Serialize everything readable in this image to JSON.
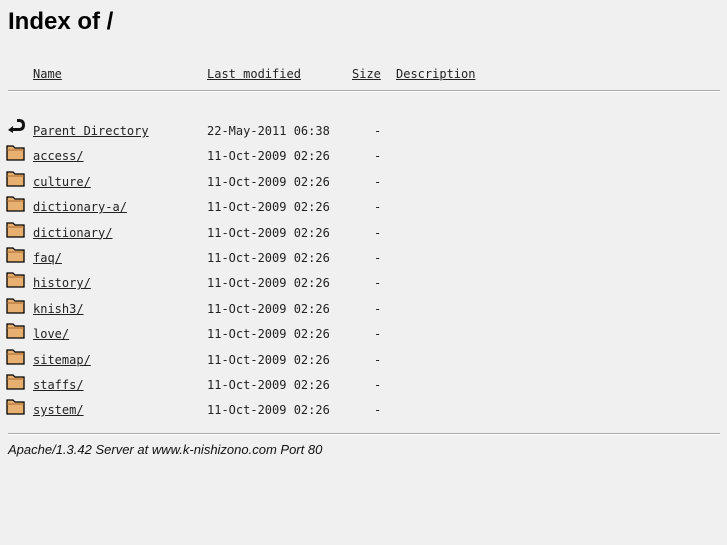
{
  "title": "Index of /",
  "headers": {
    "name": "Name",
    "last_modified": "Last modified",
    "size": "Size",
    "description": "Description"
  },
  "rows": [
    {
      "icon": "back-icon",
      "name": "Parent Directory",
      "modified": "22-May-2011 06:38",
      "size": "-"
    },
    {
      "icon": "folder-icon",
      "name": "access/",
      "modified": "11-Oct-2009 02:26",
      "size": "-"
    },
    {
      "icon": "folder-icon",
      "name": "culture/",
      "modified": "11-Oct-2009 02:26",
      "size": "-"
    },
    {
      "icon": "folder-icon",
      "name": "dictionary-a/",
      "modified": "11-Oct-2009 02:26",
      "size": "-"
    },
    {
      "icon": "folder-icon",
      "name": "dictionary/",
      "modified": "11-Oct-2009 02:26",
      "size": "-"
    },
    {
      "icon": "folder-icon",
      "name": "faq/",
      "modified": "11-Oct-2009 02:26",
      "size": "-"
    },
    {
      "icon": "folder-icon",
      "name": "history/",
      "modified": "11-Oct-2009 02:26",
      "size": "-"
    },
    {
      "icon": "folder-icon",
      "name": "knish3/",
      "modified": "11-Oct-2009 02:26",
      "size": "-"
    },
    {
      "icon": "folder-icon",
      "name": "love/",
      "modified": "11-Oct-2009 02:26",
      "size": "-"
    },
    {
      "icon": "folder-icon",
      "name": "sitemap/",
      "modified": "11-Oct-2009 02:26",
      "size": "-"
    },
    {
      "icon": "folder-icon",
      "name": "staffs/",
      "modified": "11-Oct-2009 02:26",
      "size": "-"
    },
    {
      "icon": "folder-icon",
      "name": "system/",
      "modified": "11-Oct-2009 02:26",
      "size": "-"
    }
  ],
  "footer": "Apache/1.3.42 Server at www.k-nishizono.com Port 80",
  "colors": {
    "link": "#1a1aee",
    "folder": "#e8b070",
    "background": "#f0f0f0"
  }
}
